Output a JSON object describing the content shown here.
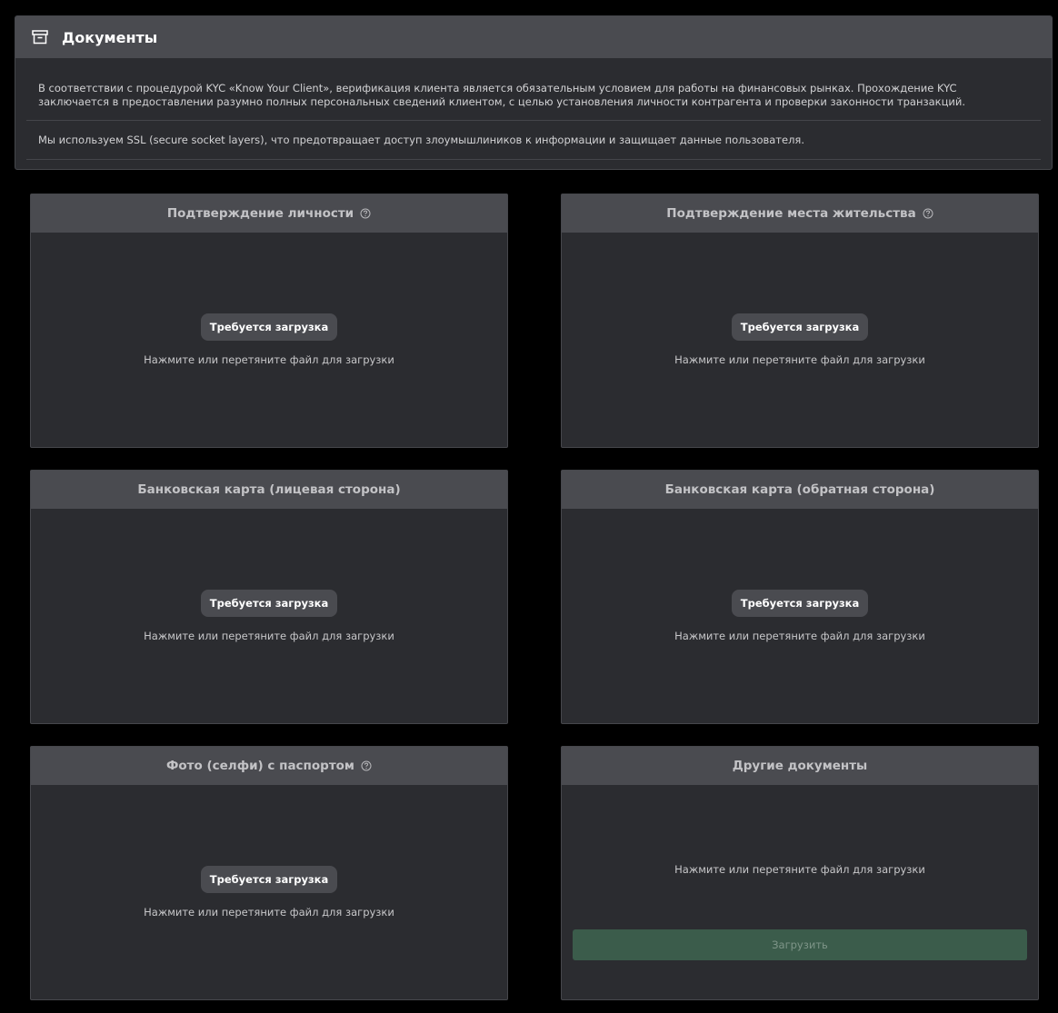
{
  "documents": {
    "title": "Документы",
    "icon": "archive-icon",
    "info": [
      "В соответствии с процедурой KYC «Know Your Client», верификация клиента является обязательным условием для работы на финансовых рынках. Прохождение KYC заключается в предоставлении разумно полных персональных сведений клиентом, с целью установления личности контрагента и проверки законности транзакций.",
      "Мы используем SSL (secure socket layers), что предотвращает доступ злоумышлиников к информации и защищает данные пользователя."
    ]
  },
  "cards": [
    {
      "title": "Подтверждение личности",
      "status": "Требуется загрузка",
      "hint": "Нажмите или перетяните файл для загрузки",
      "help_icon": "question-circle-icon"
    },
    {
      "title": "Подтверждение места жительства",
      "status": "Требуется загрузка",
      "hint": "Нажмите или перетяните файл для загрузки",
      "help_icon": "question-circle-icon"
    },
    {
      "title": "Банковская карта (лицевая сторона)",
      "status": "Требуется загрузка",
      "hint": "Нажмите или перетяните файл для загрузки"
    },
    {
      "title": "Банковская карта (обратная сторона)",
      "status": "Требуется загрузка",
      "hint": "Нажмите или перетяните файл для загрузки"
    },
    {
      "title": "Фото (селфи) с паспортом",
      "status": "Требуется загрузка",
      "hint": "Нажмите или перетяните файл для загрузки",
      "help_icon": "question-circle-icon"
    },
    {
      "title": "Другие документы",
      "hint": "Нажмите или перетяните файл для загрузки",
      "submit_label": "Загрузить"
    }
  ],
  "colors": {
    "background": "#000000",
    "panel": "#2b2c30",
    "header": "#4a4b50",
    "submit": "#3b5c4b"
  }
}
